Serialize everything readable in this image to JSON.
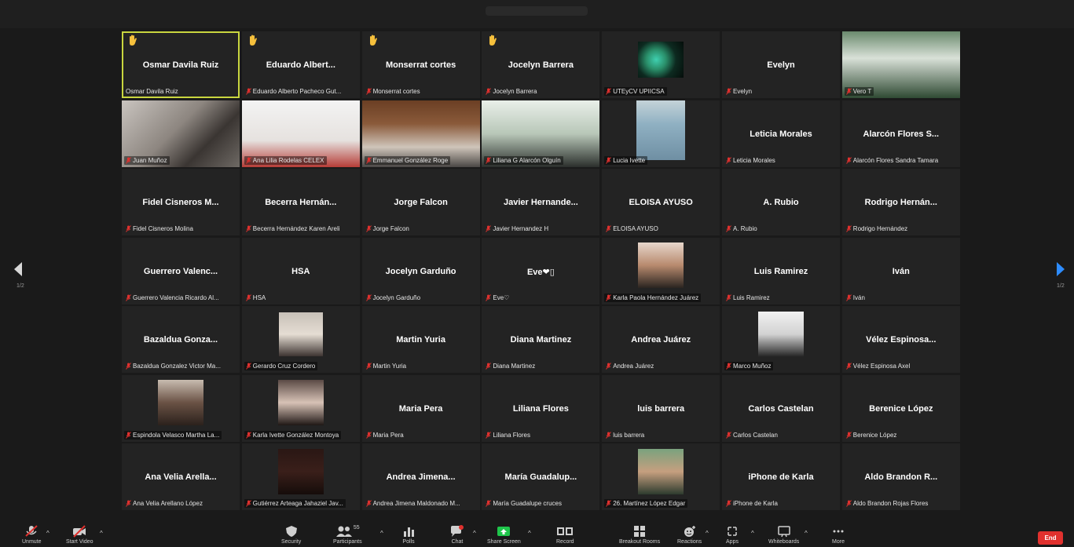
{
  "pager": {
    "left_page": "1/2",
    "right_page": "1/2"
  },
  "participants": [
    {
      "display": "Osmar Davila Ruiz",
      "label": "Osmar Davila Ruiz",
      "hand": true,
      "active": true
    },
    {
      "display": "Eduardo Albert...",
      "label": "Eduardo Alberto Pacheco Gut...",
      "hand": true
    },
    {
      "display": "Monserrat cortes",
      "label": "Monserrat cortes",
      "hand": true
    },
    {
      "display": "Jocelyn Barrera",
      "label": "Jocelyn Barrera",
      "hand": true
    },
    {
      "display": "",
      "label": "UTEyCV UPIICSA",
      "avatar": "utey"
    },
    {
      "display": "Evelyn",
      "label": "Evelyn"
    },
    {
      "display": "",
      "label": "Vero T",
      "video": "vero"
    },
    {
      "display": "",
      "label": "Juan Muñoz",
      "video": "juan"
    },
    {
      "display": "",
      "label": "Ana Lilia Rodelas CELEX",
      "video": "ana"
    },
    {
      "display": "",
      "label": "Emmanuel González Roge",
      "video": "emm"
    },
    {
      "display": "",
      "label": "Liliana G Alarcón Olguín",
      "video": "lil"
    },
    {
      "display": "",
      "label": "Lucia Ivette",
      "avatar": "lucia"
    },
    {
      "display": "Leticia Morales",
      "label": "Leticia Morales"
    },
    {
      "display": "Alarcón Flores S...",
      "label": "Alarcón Flores Sandra Tamara"
    },
    {
      "display": "Fidel Cisneros M...",
      "label": "Fidel Cisneros Molina"
    },
    {
      "display": "Becerra Hernán...",
      "label": "Becerra Hernández Karen Areli"
    },
    {
      "display": "Jorge Falcon",
      "label": "Jorge Falcon"
    },
    {
      "display": "Javier Hernande...",
      "label": "Javier Hernandez H"
    },
    {
      "display": "ELOISA AYUSO",
      "label": "ELOISA AYUSO"
    },
    {
      "display": "A. Rubio",
      "label": "A. Rubio"
    },
    {
      "display": "Rodrigo Hernán...",
      "label": "Rodrigo Hernández"
    },
    {
      "display": "Guerrero Valenc...",
      "label": "Guerrero Valencia Ricardo Al..."
    },
    {
      "display": "HSA",
      "label": "HSA"
    },
    {
      "display": "Jocelyn Garduño",
      "label": "Jocelyn Garduño"
    },
    {
      "display": "Eve❤▯",
      "label": "Eve♡"
    },
    {
      "display": "",
      "label": "Karla Paola Hernández Juárez",
      "avatar": "karlap"
    },
    {
      "display": "Luis Ramirez",
      "label": "Luis Ramirez"
    },
    {
      "display": "Iván",
      "label": "Iván"
    },
    {
      "display": "Bazaldua Gonza...",
      "label": "Bazaldua Gonzalez Victor Ma..."
    },
    {
      "display": "",
      "label": "Gerardo Cruz Cordero",
      "avatar": "gerardo"
    },
    {
      "display": "Martin Yuria",
      "label": "Martin Yuria"
    },
    {
      "display": "Diana Martinez",
      "label": "Diana Martinez"
    },
    {
      "display": "Andrea Juárez",
      "label": "Andrea Juárez"
    },
    {
      "display": "",
      "label": "Marco Muñoz",
      "avatar": "marco"
    },
    {
      "display": "Vélez Espinosa...",
      "label": "Vélez Espinosa Axel"
    },
    {
      "display": "",
      "label": "Espindola Velasco Martha La...",
      "avatar": "martha"
    },
    {
      "display": "",
      "label": "Karla Ivette González Montoya",
      "avatar": "karlai"
    },
    {
      "display": "Maria Pera",
      "label": "Maria Pera"
    },
    {
      "display": "Liliana Flores",
      "label": "Liliana Flores"
    },
    {
      "display": "luis barrera",
      "label": "luis barrera"
    },
    {
      "display": "Carlos Castelan",
      "label": "Carlos Castelan"
    },
    {
      "display": "Berenice López",
      "label": "Berenice López"
    },
    {
      "display": "Ana Velia Arella...",
      "label": "Ana Velia Arellano López"
    },
    {
      "display": "",
      "label": "Gutiérrez Arteaga Jahaziel Jav...",
      "avatar": "jahaziel"
    },
    {
      "display": "Andrea Jimena...",
      "label": "Andrea Jimena Maldonado M..."
    },
    {
      "display": "María Guadalup...",
      "label": "María Guadalupe cruces"
    },
    {
      "display": "",
      "label": "26. Martínez López Edgar",
      "avatar": "edgar"
    },
    {
      "display": "iPhone de Karla",
      "label": "iPhone de Karla"
    },
    {
      "display": "Aldo Brandon R...",
      "label": "Aldo Brandon Rojas Flores"
    }
  ],
  "toolbar": {
    "mute": "Unmute",
    "video": "Start Video",
    "security": "Security",
    "participants": "Participants",
    "participants_count": "55",
    "polls": "Polls",
    "chat": "Chat",
    "share": "Share Screen",
    "record": "Record",
    "breakout": "Breakout Rooms",
    "reactions": "Reactions",
    "apps": "Apps",
    "whiteboards": "Whiteboards",
    "more": "More",
    "end": "End"
  },
  "colors": {
    "accent_active": "#c9d63f",
    "share_green": "#1fc54b",
    "end_red": "#e0312e",
    "raised_hand": "#f6c03c",
    "muted_red": "#e0312e"
  }
}
